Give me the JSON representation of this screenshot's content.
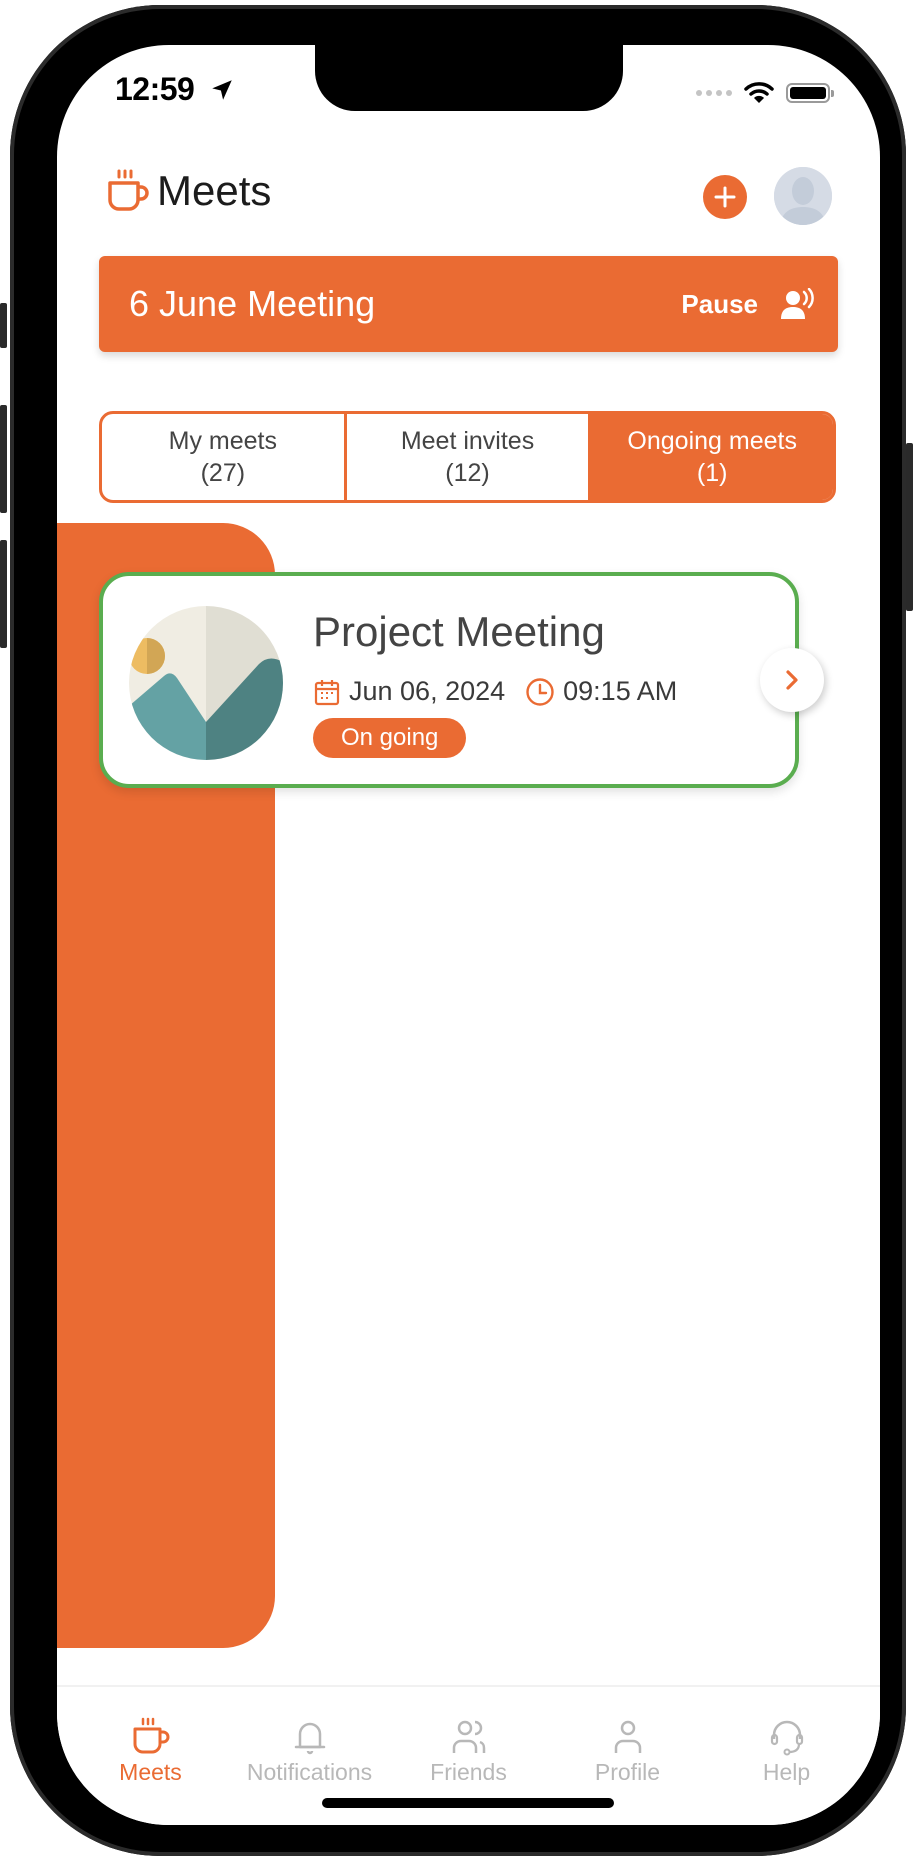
{
  "status_bar": {
    "time": "12:59"
  },
  "header": {
    "title": "Meets",
    "add_button_label": "+"
  },
  "banner": {
    "title": "6 June Meeting",
    "action_label": "Pause"
  },
  "tabs": [
    {
      "label": "My meets",
      "count": "(27)",
      "active": false
    },
    {
      "label": "Meet invites",
      "count": "(12)",
      "active": false
    },
    {
      "label": "Ongoing meets",
      "count": "(1)",
      "active": true
    }
  ],
  "meetings": [
    {
      "title": "Project Meeting",
      "date": "Jun 06, 2024",
      "time": "09:15 AM",
      "status": "On going"
    }
  ],
  "bottom_nav": [
    {
      "label": "Meets",
      "icon": "coffee-cup-icon",
      "active": true
    },
    {
      "label": "Notifications",
      "icon": "bell-icon",
      "active": false
    },
    {
      "label": "Friends",
      "icon": "friends-icon",
      "active": false
    },
    {
      "label": "Profile",
      "icon": "profile-icon",
      "active": false
    },
    {
      "label": "Help",
      "icon": "headset-icon",
      "active": false
    }
  ],
  "colors": {
    "accent": "#ea6b33",
    "card_border": "#5aad4f",
    "inactive": "#b8b8b8"
  }
}
